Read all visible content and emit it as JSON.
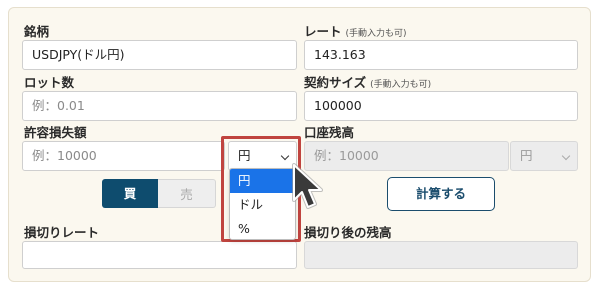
{
  "left": {
    "symbol_label": "銘柄",
    "symbol_value": "USDJPY(ドル円)",
    "lot_label": "ロット数",
    "lot_placeholder": "例：0.01",
    "risk_label": "許容損失額",
    "risk_placeholder": "例：10000",
    "risk_unit_value": "円",
    "buy_label": "買",
    "sell_label": "売",
    "stop_label": "損切りレート"
  },
  "right": {
    "rate_label": "レート",
    "rate_note": "(手動入力も可)",
    "rate_value": "143.163",
    "contract_label": "契約サイズ",
    "contract_note": "(手動入力も可)",
    "contract_value": "100000",
    "balance_label": "口座残高",
    "balance_placeholder": "例：10000",
    "balance_unit": "円",
    "calc_label": "計算する",
    "after_label": "損切り後の残高"
  },
  "dropdown": {
    "options": [
      "円",
      "ドル",
      "%"
    ],
    "selected_index": 0
  },
  "colors": {
    "accent": "#0e4c6e",
    "highlight": "#c0443f",
    "option_selected": "#1a73e8",
    "card_bg": "#fbf8ef"
  }
}
